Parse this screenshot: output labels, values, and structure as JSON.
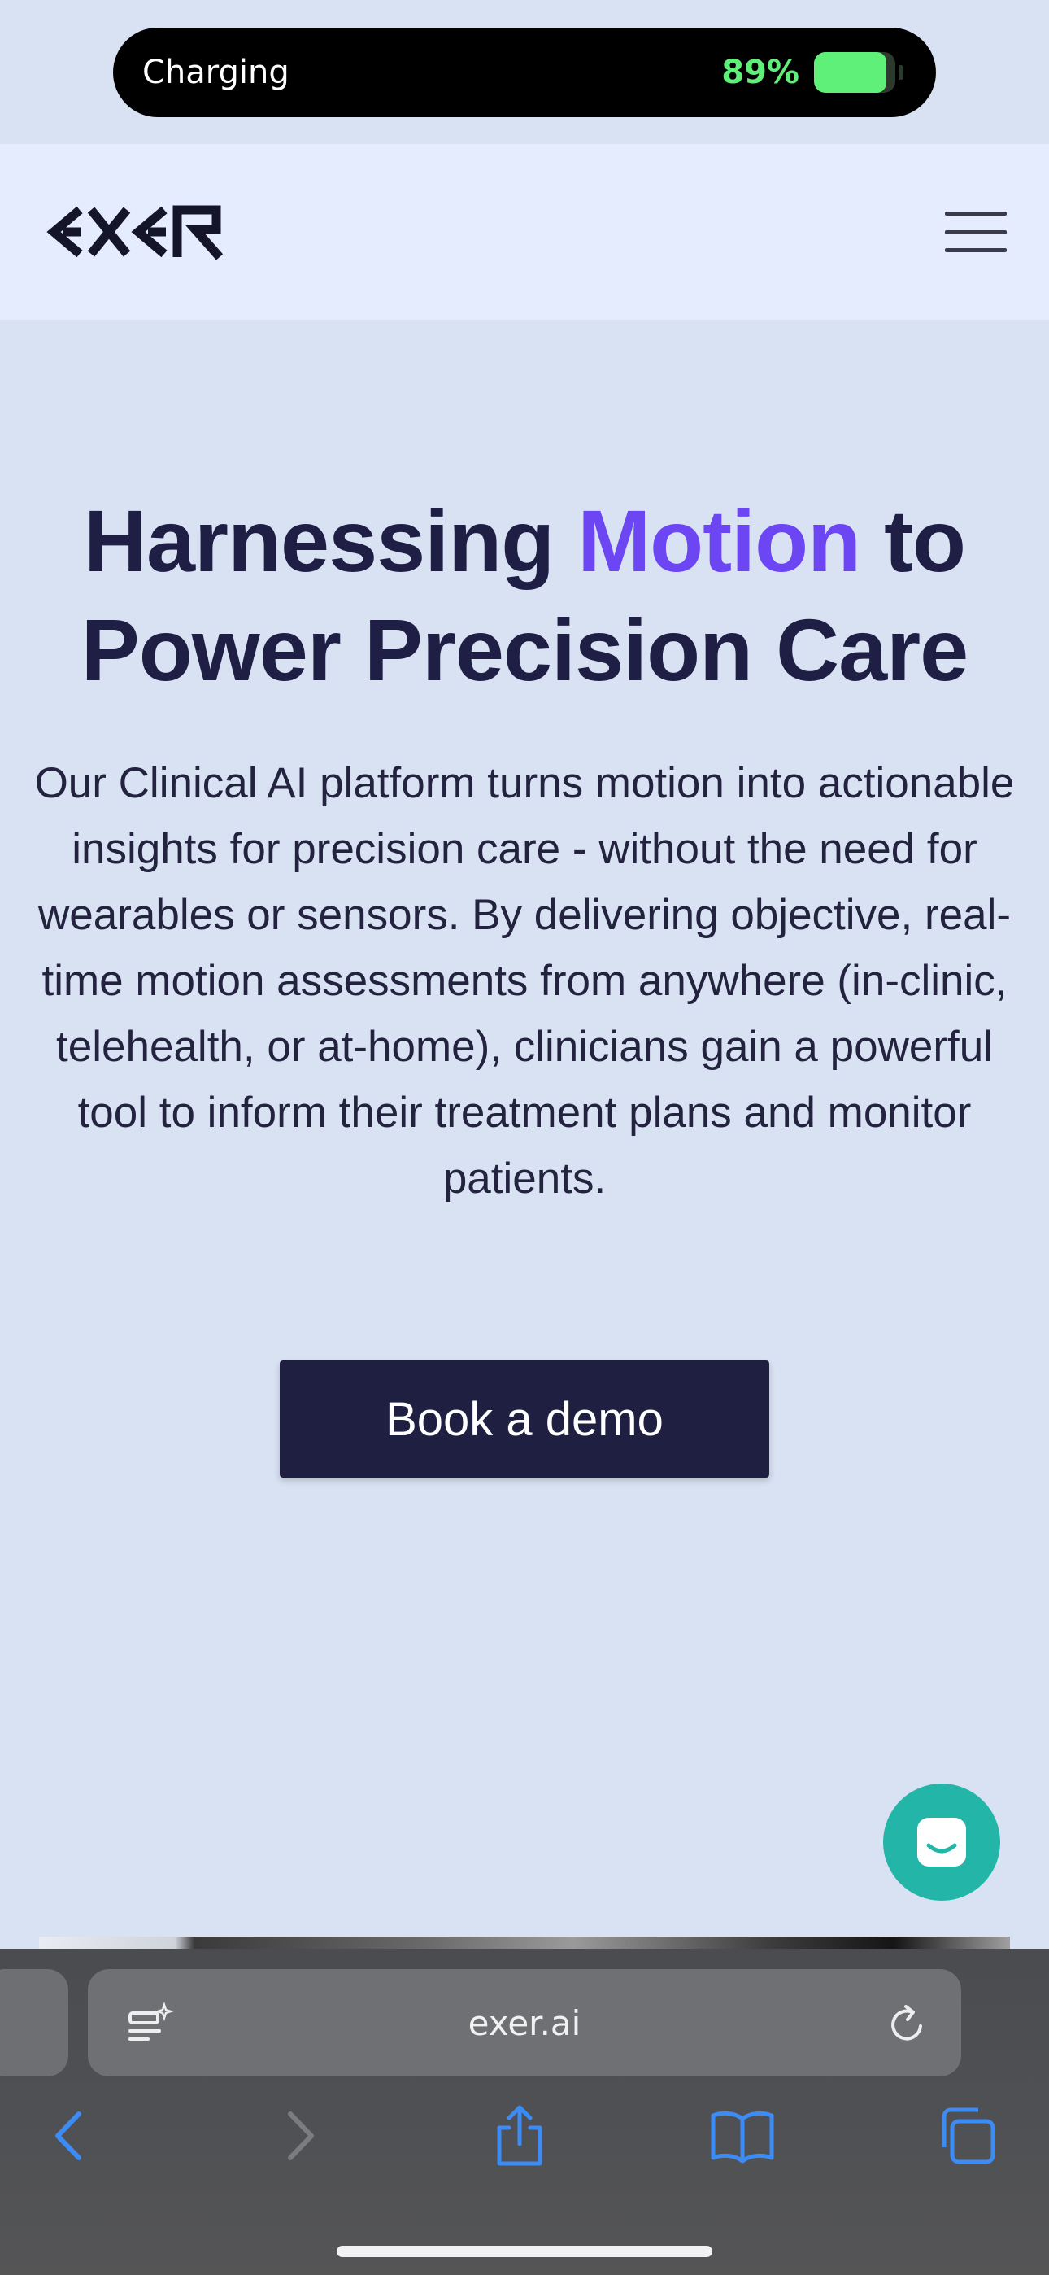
{
  "status": {
    "label": "Charging",
    "battery_percent": "89%",
    "battery_level": 0.89,
    "accent": "#5ff07a"
  },
  "header": {
    "logo_icon": "exer-logo-icon",
    "menu_icon": "hamburger-menu-icon"
  },
  "hero": {
    "title_part1": "Harnessing ",
    "title_accent": "Motion",
    "title_part2": " to Power Precision Care",
    "accent_color": "#6c46f2",
    "description": "Our Clinical AI platform turns motion into actionable insights for precision care - without the need for wearables or sensors. By delivering objective, real-time motion assessments from anywhere (in-clinic, telehealth, or at-home), clinicians gain a powerful tool to inform their treatment plans and monitor patients.",
    "cta_label": "Book a demo"
  },
  "chat": {
    "icon": "chat-bubble-icon",
    "color": "#23b5a7"
  },
  "browser": {
    "url": "exer.ai",
    "reader_icon": "page-menu-icon",
    "reload_icon": "reload-icon",
    "toolbar": [
      "back-icon",
      "forward-icon",
      "share-icon",
      "bookmarks-icon",
      "tabs-icon"
    ]
  }
}
